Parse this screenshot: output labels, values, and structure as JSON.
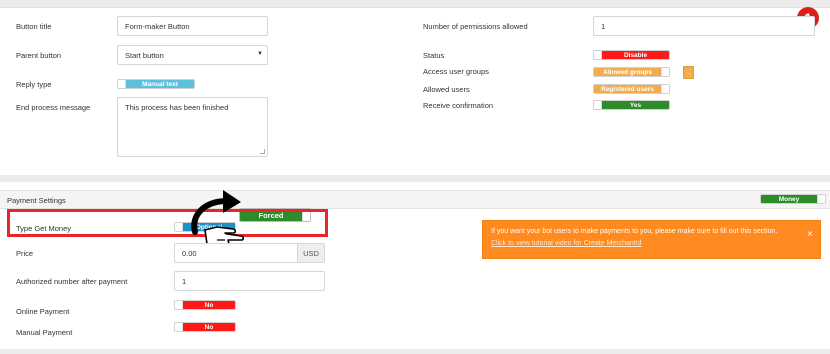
{
  "colors": {
    "red": "#ff1a1a",
    "green": "#2e8b2a",
    "orange": "#f0ad4e",
    "blue": "#5bc0de",
    "alert": "#ff8a1f",
    "highlight": "#e8262a"
  },
  "step_badge": "1",
  "left_fields": {
    "button_title": {
      "label": "Button title",
      "value": "Form-maker Button"
    },
    "parent_button": {
      "label": "Parent button",
      "value": "Start button"
    },
    "reply_type": {
      "label": "Reply type",
      "value": "Manual text"
    },
    "end_message": {
      "label": "End process message",
      "value": "This process has been finished"
    }
  },
  "right_fields": {
    "permissions": {
      "label": "Number of permissions allowed",
      "value": "1"
    },
    "status": {
      "label": "Status",
      "value": "Disable"
    },
    "access_groups": {
      "label": "Access user groups",
      "value": "Allowed groups",
      "extra_button": "..."
    },
    "allowed_users": {
      "label": "Allowed users",
      "value": "Registered users"
    },
    "receive_confirmation": {
      "label": "Receive confirmation",
      "value": "Yes"
    }
  },
  "payment": {
    "section_title": "Payment Settings",
    "money_toggle": "Money",
    "type_get_money": {
      "label": "Type Get Money",
      "value": "Optional",
      "popup_value": "Forced"
    },
    "price": {
      "label": "Price",
      "value": "0.00",
      "unit": "USD"
    },
    "authorized_number": {
      "label": "Authorized number after payment",
      "value": "1"
    },
    "online_payment": {
      "label": "Online Payment",
      "value": "No"
    },
    "manual_payment": {
      "label": "Manual Payment",
      "value": "No"
    }
  },
  "alert": {
    "message": "If you want your bot users to make payments to you, please make sure to fill out this section.",
    "link": "Click to view tutorial video for Create MerchantId",
    "close": "×"
  },
  "icons": {
    "arrow": "curved-arrow-icon",
    "hand": "pointing-hand-icon",
    "dropdown": "caret-down-icon"
  }
}
